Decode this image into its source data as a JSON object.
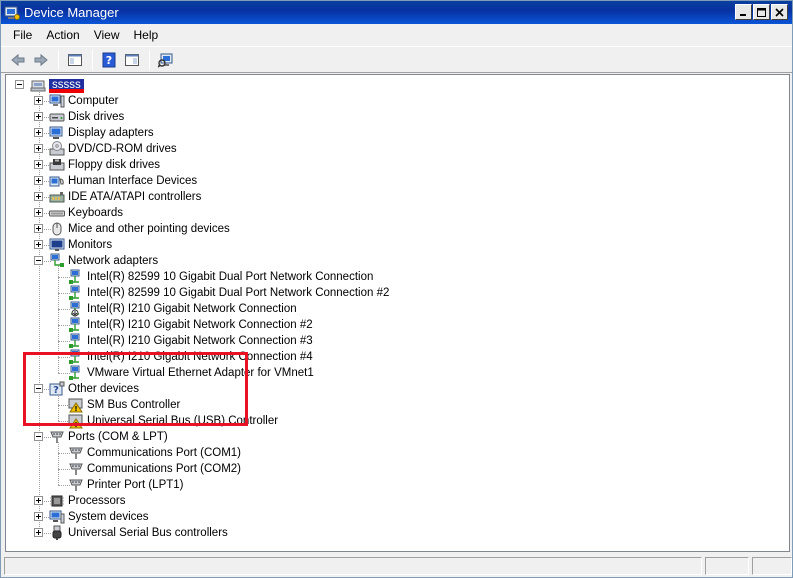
{
  "window": {
    "title": "Device Manager"
  },
  "titlebar_buttons": [
    "0",
    "1",
    "r"
  ],
  "menu": [
    "File",
    "Action",
    "View",
    "Help"
  ],
  "toolbar": {
    "buttons": [
      "back-icon",
      "forward-icon",
      "show-hide-tree-icon",
      "help-icon",
      "properties-icon",
      "scan-hardware-icon"
    ]
  },
  "tree": {
    "root": "sssss",
    "categories": [
      {
        "label": "Computer",
        "icon": "computer-icon",
        "expanded": false
      },
      {
        "label": "Disk drives",
        "icon": "disk-drive-icon",
        "expanded": false
      },
      {
        "label": "Display adapters",
        "icon": "display-adapter-icon",
        "expanded": false
      },
      {
        "label": "DVD/CD-ROM drives",
        "icon": "dvd-drive-icon",
        "expanded": false
      },
      {
        "label": "Floppy disk drives",
        "icon": "floppy-drive-icon",
        "expanded": false
      },
      {
        "label": "Human Interface Devices",
        "icon": "hid-icon",
        "expanded": false
      },
      {
        "label": "IDE ATA/ATAPI controllers",
        "icon": "ide-controller-icon",
        "expanded": false
      },
      {
        "label": "Keyboards",
        "icon": "keyboard-icon",
        "expanded": false
      },
      {
        "label": "Mice and other pointing devices",
        "icon": "mouse-icon",
        "expanded": false
      },
      {
        "label": "Monitors",
        "icon": "monitor-icon",
        "expanded": false
      },
      {
        "label": "Network adapters",
        "icon": "network-adapter-icon",
        "expanded": true,
        "children": [
          "Intel(R) 82599 10 Gigabit Dual Port Network Connection",
          "Intel(R) 82599 10 Gigabit Dual Port Network Connection #2",
          "Intel(R) I210 Gigabit Network Connection",
          "Intel(R) I210 Gigabit Network Connection #2",
          "Intel(R) I210 Gigabit Network Connection #3",
          "Intel(R) I210 Gigabit Network Connection #4",
          "VMware Virtual Ethernet Adapter for VMnet1"
        ]
      },
      {
        "label": "Other devices",
        "icon": "other-devices-icon",
        "expanded": true,
        "children": [
          "SM Bus Controller",
          "Universal Serial Bus (USB) Controller"
        ]
      },
      {
        "label": "Ports (COM & LPT)",
        "icon": "port-icon",
        "expanded": true,
        "children": [
          "Communications Port (COM1)",
          "Communications Port (COM2)",
          "Printer Port (LPT1)"
        ]
      },
      {
        "label": "Processors",
        "icon": "processor-icon",
        "expanded": false
      },
      {
        "label": "System devices",
        "icon": "system-device-icon",
        "expanded": false
      },
      {
        "label": "Universal Serial Bus controllers",
        "icon": "usb-controller-icon",
        "expanded": false
      }
    ]
  },
  "colors": {
    "titlebar": "#0a3f9e",
    "highlight": "#e81224",
    "selection": "#1f2f9f"
  }
}
